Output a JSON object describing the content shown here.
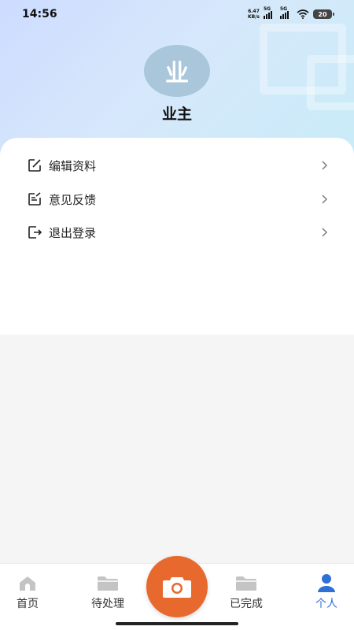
{
  "status_bar": {
    "time": "14:56",
    "net_speed_value": "6.47",
    "net_speed_unit": "KB/s",
    "sim1_label": "5G",
    "sim2_label": "5G",
    "battery": "20"
  },
  "profile": {
    "avatar_text": "业",
    "name": "业主"
  },
  "menu": {
    "items": [
      {
        "label": "编辑资料",
        "icon": "edit-icon"
      },
      {
        "label": "意见反馈",
        "icon": "feedback-icon"
      },
      {
        "label": "退出登录",
        "icon": "logout-icon"
      }
    ]
  },
  "tabbar": {
    "tabs": [
      {
        "label": "首页",
        "icon": "home-icon"
      },
      {
        "label": "待处理",
        "icon": "folder-icon"
      },
      {
        "label": "已完成",
        "icon": "folder-icon"
      },
      {
        "label": "个人",
        "icon": "person-icon"
      }
    ],
    "active": "个人",
    "center_button_icon": "camera-icon"
  },
  "colors": {
    "accent": "#2f6fd8",
    "camera_button": "#e8692e",
    "avatar_bg": "#a9c6da"
  }
}
